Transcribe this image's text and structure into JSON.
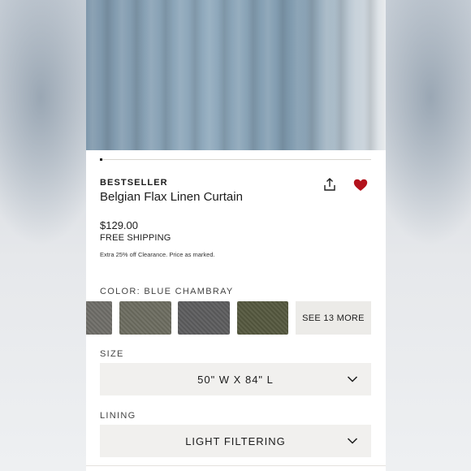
{
  "product": {
    "badge": "BESTSELLER",
    "title": "Belgian Flax Linen Curtain",
    "price": "$129.00",
    "shipping": "FREE SHIPPING",
    "promo": "Extra 25% off Clearance. Price as marked."
  },
  "gallery": {
    "progress": 0.01
  },
  "color": {
    "label": "COLOR: BLUE CHAMBRAY",
    "swatches": [
      {
        "name": "swatch-1",
        "color": "#6f6d68"
      },
      {
        "name": "swatch-2",
        "color": "#6c6c60"
      },
      {
        "name": "swatch-3",
        "color": "#5c5c5e"
      },
      {
        "name": "swatch-4",
        "color": "#55583f"
      }
    ],
    "see_more": "SEE 13 MORE"
  },
  "size": {
    "label": "SIZE",
    "value": "50\" W X 84\" L"
  },
  "lining": {
    "label": "LINING",
    "value": "LIGHT FILTERING"
  },
  "icons": {
    "share": "share-icon",
    "favorite": "heart-icon",
    "chevron": "chevron-down-icon"
  },
  "colors": {
    "heart": "#b3121c",
    "text": "#1c1c1c",
    "select_bg": "#f1f0ee"
  }
}
